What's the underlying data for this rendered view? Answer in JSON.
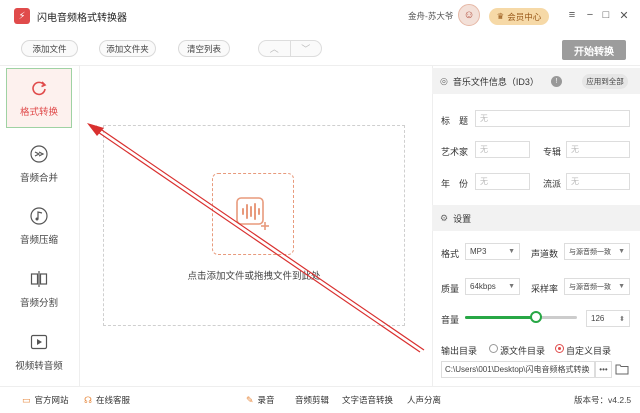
{
  "app": {
    "title": "闪电音频格式转换器",
    "logo_text": "⚡"
  },
  "titlebar": {
    "user": "金舟-苏大爷",
    "vip_label": "会员中心"
  },
  "toolbar": {
    "add_file": "添加文件",
    "add_folder": "添加文件夹",
    "clear_list": "清空列表",
    "start": "开始转换"
  },
  "sidebar": {
    "items": [
      {
        "label": "格式转换",
        "icon": "format-convert-icon",
        "active": true
      },
      {
        "label": "音频合并",
        "icon": "merge-icon",
        "active": false
      },
      {
        "label": "音频压缩",
        "icon": "compress-icon",
        "active": false
      },
      {
        "label": "音频分割",
        "icon": "split-icon",
        "active": false
      },
      {
        "label": "视频转音频",
        "icon": "video-to-audio-icon",
        "active": false
      }
    ]
  },
  "dropzone": {
    "text": "点击添加文件或拖拽文件到此处"
  },
  "id3": {
    "heading": "音乐文件信息（ID3）",
    "apply_all": "应用到全部",
    "title_label": "标　题",
    "artist_label": "艺术家",
    "album_label": "专辑",
    "year_label": "年　份",
    "genre_label": "流派",
    "placeholder": "无"
  },
  "settings": {
    "heading": "设置",
    "format_label": "格式",
    "format_value": "MP3",
    "channels_label": "声道数",
    "channels_value": "与源音频一致",
    "quality_label": "质量",
    "quality_value": "64kbps",
    "samplerate_label": "采样率",
    "samplerate_value": "与源音频一致",
    "volume_label": "音量",
    "volume_value": "126",
    "volume_fraction": 0.63,
    "output_label": "输出目录",
    "source_dir_label": "源文件目录",
    "custom_dir_label": "自定义目录",
    "output_path": "C:\\Users\\001\\Desktop\\闪电音频格式转换",
    "browse_label": "•••"
  },
  "footer": {
    "website": "官方网站",
    "support": "在线客服",
    "record": "录音",
    "audio_edit": "音频剪辑",
    "tts": "文字语音转换",
    "vocal": "人声分离",
    "version": "版本号：v4.2.5"
  },
  "colors": {
    "accent": "#e04b4b",
    "annotation_arrow": "#d9302f",
    "slider": "#27a745"
  }
}
